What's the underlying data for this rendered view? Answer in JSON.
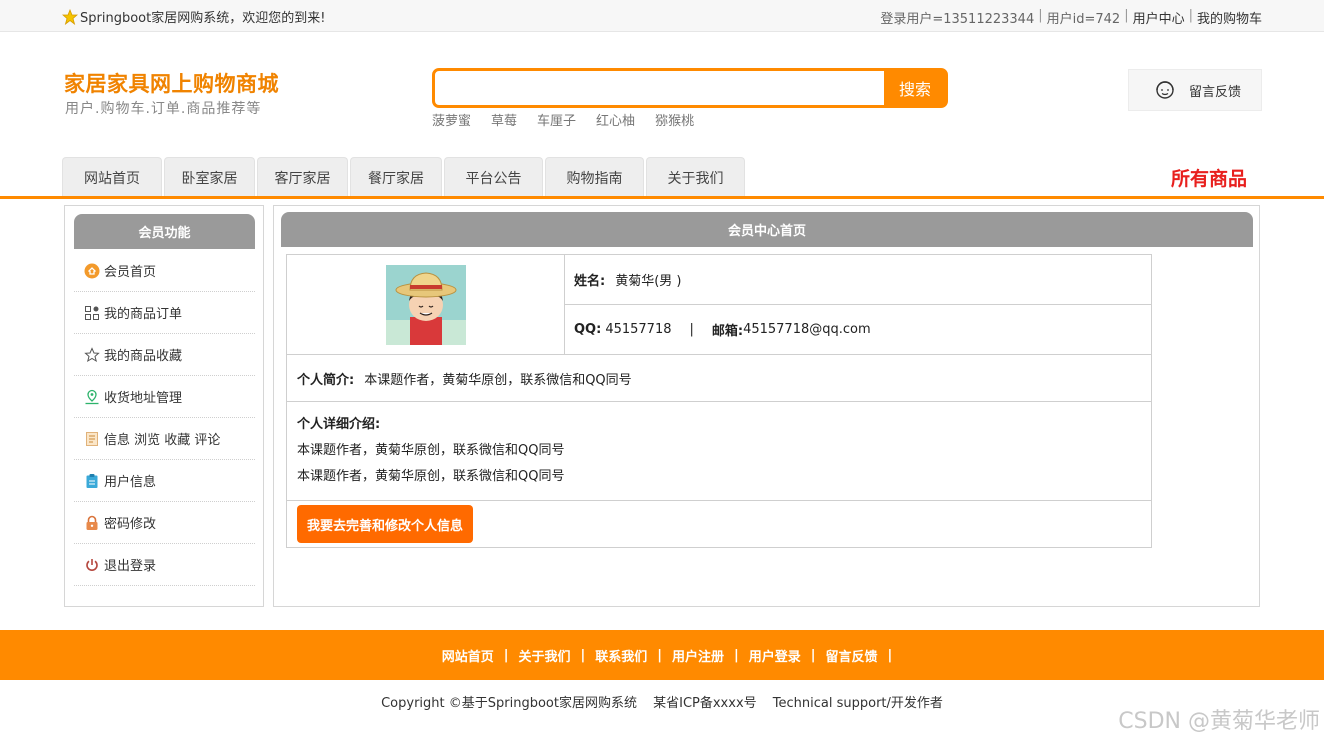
{
  "topbar": {
    "welcome": "Springboot家居网购系统，欢迎您的到来!",
    "login_user": "登录用户=13511223344",
    "user_id": "用户id=742",
    "user_center": "用户中心",
    "cart": "我的购物车",
    "sep": "|"
  },
  "header": {
    "title": "家居家具网上购物商城",
    "subtitle": "用户.购物车.订单.商品推荐等",
    "search_button": "搜索",
    "hotwords": [
      "菠萝蜜",
      "草莓",
      "车厘子",
      "红心柚",
      "猕猴桃"
    ],
    "feedback": "留言反馈"
  },
  "nav": {
    "items": [
      "网站首页",
      "卧室家居",
      "客厅家居",
      "餐厅家居",
      "平台公告",
      "购物指南",
      "关于我们"
    ],
    "all_goods": "所有商品"
  },
  "sidebar": {
    "title": "会员功能",
    "items": [
      {
        "label": "会员首页",
        "icon": "home-icon"
      },
      {
        "label": "我的商品订单",
        "icon": "order-icon"
      },
      {
        "label": "我的商品收藏",
        "icon": "star-icon"
      },
      {
        "label": "收货地址管理",
        "icon": "location-icon"
      },
      {
        "label": "信息 浏览 收藏 评论",
        "icon": "document-icon"
      },
      {
        "label": "用户信息",
        "icon": "clipboard-icon"
      },
      {
        "label": "密码修改",
        "icon": "lock-icon"
      },
      {
        "label": "退出登录",
        "icon": "power-icon"
      }
    ]
  },
  "main": {
    "title": "会员中心首页",
    "name_label": "姓名:",
    "name_value": "黄菊华(男 )",
    "qq_label": "QQ:",
    "qq_value": "45157718",
    "divider": "|",
    "email_label": "邮箱:",
    "email_value": "45157718@qq.com",
    "intro_label": "个人简介:",
    "intro_value": "本课题作者，黄菊华原创，联系微信和QQ同号",
    "detail_label": "个人详细介绍:",
    "detail_lines": [
      "本课题作者，黄菊华原创，联系微信和QQ同号",
      "本课题作者，黄菊华原创，联系微信和QQ同号"
    ],
    "edit_button": "我要去完善和修改个人信息"
  },
  "footer": {
    "links": [
      "网站首页",
      "关于我们",
      "联系我们",
      "用户注册",
      "用户登录",
      "留言反馈"
    ],
    "sep": "|",
    "copyright": "Copyright ©基于Springboot家居网购系统",
    "icp": "某省ICP备xxxx号",
    "support": "Technical support/开发作者"
  },
  "watermark": "CSDN @黄菊华老师",
  "colors": {
    "accent": "#ff8a00",
    "button": "#ff6a00",
    "title": "#f08300",
    "all_goods": "#e8201e",
    "panel_head": "#9a9a9a"
  }
}
